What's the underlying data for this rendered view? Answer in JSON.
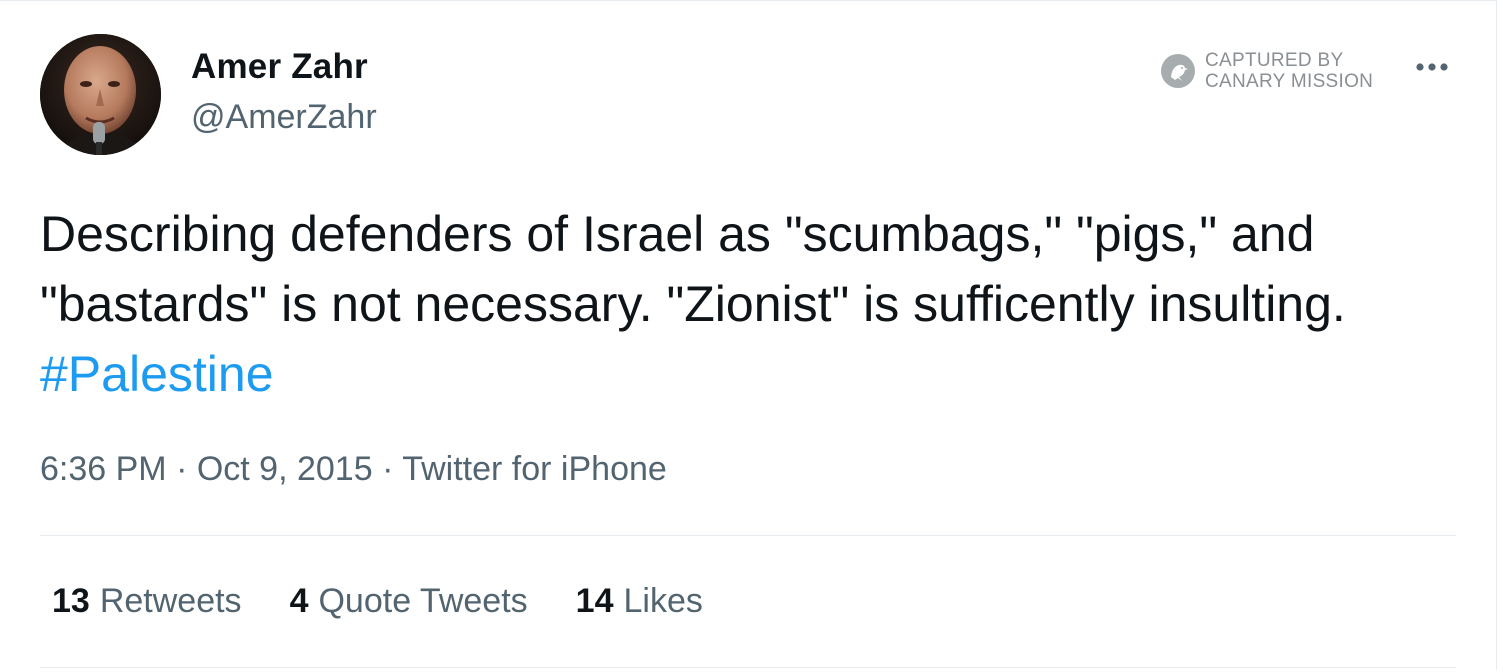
{
  "author": {
    "display_name": "Amer Zahr",
    "handle": "@AmerZahr",
    "avatar_icon": "profile-photo"
  },
  "watermark": {
    "line1": "CAPTURED BY",
    "line2": "CANARY MISSION",
    "icon": "canary-bird-icon"
  },
  "more_icon": "ellipsis-icon",
  "tweet": {
    "text_before": "Describing defenders of Israel as \"scumbags,\" \"pigs,\" and \"bastards\" is not necessary. \"Zionist\" is sufficently insulting. ",
    "hashtag": "#Palestine"
  },
  "meta": {
    "time": "6:36 PM",
    "sep1": " · ",
    "date": "Oct 9, 2015",
    "sep2": " · ",
    "source": "Twitter for iPhone"
  },
  "stats": {
    "retweets_count": "13",
    "retweets_label": "Retweets",
    "quotes_count": "4",
    "quotes_label": "Quote Tweets",
    "likes_count": "14",
    "likes_label": "Likes"
  },
  "colors": {
    "text": "#0f1419",
    "secondary": "#536471",
    "link": "#1d9bf0",
    "divider": "#e6ecf0",
    "watermark": "#8a8f93"
  }
}
